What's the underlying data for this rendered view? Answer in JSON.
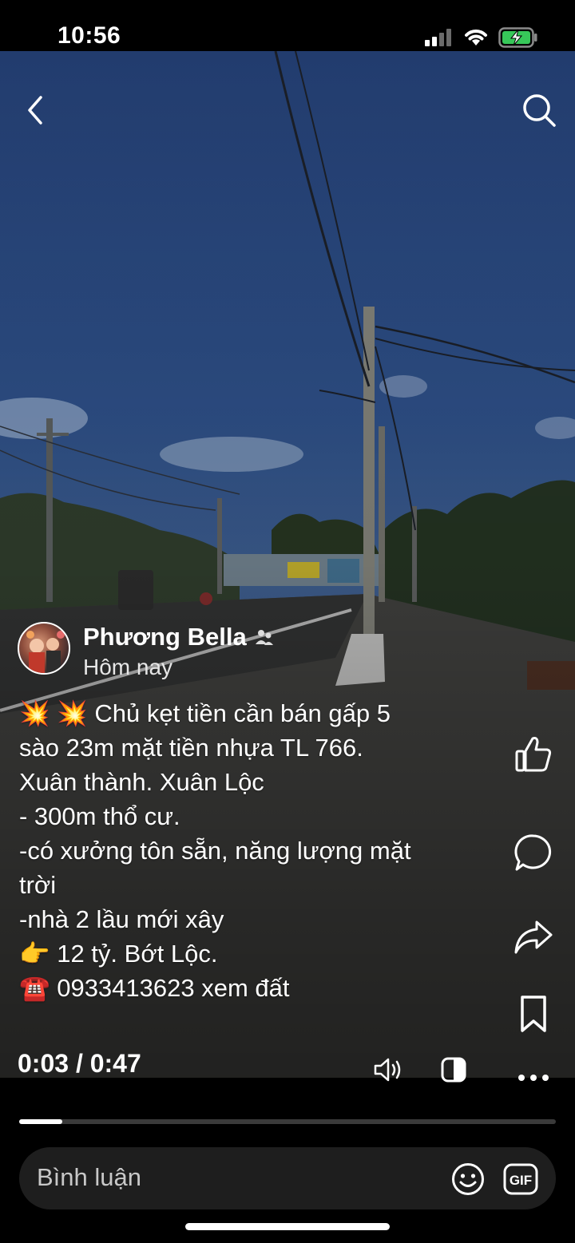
{
  "status_bar": {
    "time": "10:56",
    "battery": "charging"
  },
  "header": {
    "back_icon": "chevron-left-icon",
    "search_icon": "search-icon"
  },
  "post": {
    "author": "Phương Bella",
    "author_badge_icon": "friends-icon",
    "time": "Hôm nay",
    "caption": "💥 💥 Chủ kẹt tiền cần bán gấp 5\nsào 23m mặt tiền nhựa TL 766.\nXuân thành. Xuân Lộc\n- 300m thổ cư.\n-có xưởng tôn sẵn, năng lượng mặt\ntrời\n-nhà 2 lầu mới xây\n👉 12 tỷ. Bớt Lộc.\n☎️ 0933413623 xem đất"
  },
  "actions": [
    {
      "name": "like",
      "icon": "thumbs-up-icon"
    },
    {
      "name": "comment",
      "icon": "comment-icon"
    },
    {
      "name": "share",
      "icon": "share-icon"
    },
    {
      "name": "save",
      "icon": "bookmark-icon"
    },
    {
      "name": "more",
      "icon": "more-icon"
    }
  ],
  "player": {
    "current": "0:03",
    "separator": " / ",
    "duration": "0:47",
    "progress": 0.08,
    "volume_icon": "volume-icon",
    "mode_icon": "contrast-icon"
  },
  "comment": {
    "placeholder": "Bình luận",
    "emoji_icon": "emoji-icon",
    "gif_label": "GIF"
  }
}
